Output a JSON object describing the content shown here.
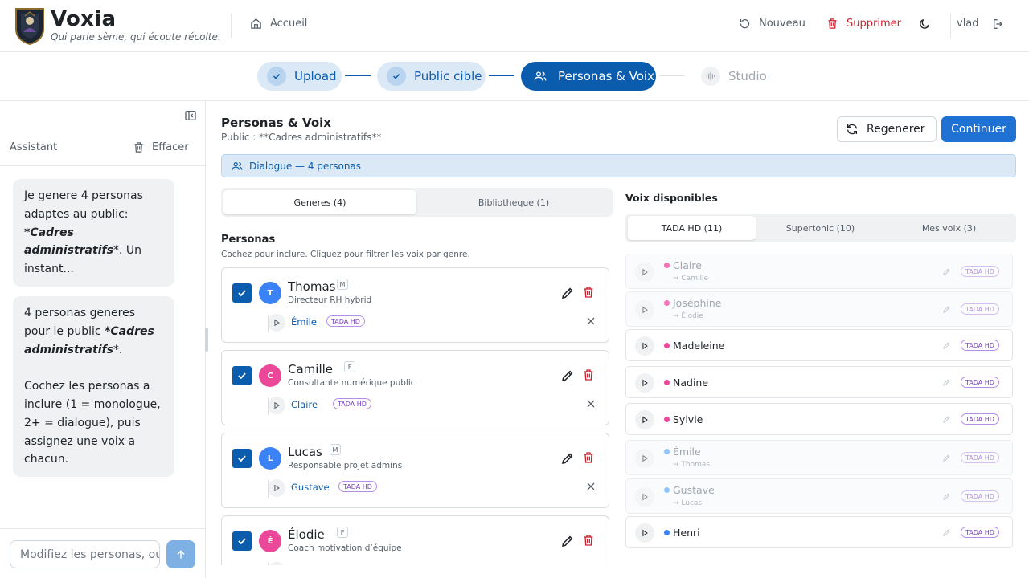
{
  "header": {
    "brand": "Voxia",
    "tagline": "Qui parle sème, qui écoute récolte.",
    "home_label": "Accueil",
    "new_label": "Nouveau",
    "delete_label": "Supprimer",
    "user": "vlad"
  },
  "stepper": [
    {
      "label": "Upload",
      "state": "done"
    },
    {
      "label": "Public cible",
      "state": "done"
    },
    {
      "label": "Personas & Voix",
      "state": "active"
    },
    {
      "label": "Studio",
      "state": "todo"
    }
  ],
  "sidebar": {
    "title": "Assistant",
    "clear_label": "Effacer",
    "messages": [
      {
        "parts": [
          {
            "t": "Je genere 4 personas adaptes au public: "
          },
          {
            "b": "*Cadres administratifs"
          },
          {
            "t": "*. Un instant..."
          }
        ]
      },
      {
        "parts": [
          {
            "t": "4 personas generes pour le public "
          },
          {
            "b": "*Cadres administratifs"
          },
          {
            "t": "*.\n\nCochez les personas a inclure (1 = monologue, 2+ = dialogue), puis assignez une voix a chacun."
          }
        ]
      }
    ],
    "input_placeholder": "Modifiez les personas, ou posez une question..."
  },
  "main": {
    "title": "Personas & Voix",
    "subtitle": "Public : **Cadres administratifs**",
    "regen_label": "Regenerer",
    "continue_label": "Continuer",
    "banner": "Dialogue — 4 personas",
    "persona_tabs": [
      "Generes (4)",
      "Bibliotheque (1)"
    ],
    "personas_title": "Personas",
    "personas_hint": "Cochez pour inclure. Cliquez pour filtrer les voix par genre.",
    "personas": [
      {
        "initial": "T",
        "name": "Thomas",
        "gender": "M",
        "role": "Directeur RH hybrid",
        "voice": "Émile",
        "engine": "TADA HD",
        "color": "#3b82f6",
        "checked": true
      },
      {
        "initial": "C",
        "name": "Camille",
        "gender": "F",
        "role": "Consultante numérique public",
        "voice": "Claire",
        "engine": "TADA HD",
        "color": "#ec4899",
        "checked": true
      },
      {
        "initial": "L",
        "name": "Lucas",
        "gender": "M",
        "role": "Responsable projet admins",
        "voice": "Gustave",
        "engine": "TADA HD",
        "color": "#3b82f6",
        "checked": true
      },
      {
        "initial": "É",
        "name": "Élodie",
        "gender": "F",
        "role": "Coach motivation d’équipe",
        "voice": "",
        "engine": "",
        "color": "#ec4899",
        "checked": true
      }
    ],
    "voices_title": "Voix disponibles",
    "voice_tabs": [
      "TADA HD (11)",
      "Supertonic (10)",
      "Mes voix (3)"
    ],
    "voices": [
      {
        "name": "Claire",
        "used_by": "→ Camille",
        "engine": "TADA HD",
        "gender_color": "#f472b6",
        "used": true
      },
      {
        "name": "Joséphine",
        "used_by": "→ Élodie",
        "engine": "TADA HD",
        "gender_color": "#f472b6",
        "used": true
      },
      {
        "name": "Madeleine",
        "used_by": "",
        "engine": "TADA HD",
        "gender_color": "#ec4899",
        "used": false
      },
      {
        "name": "Nadine",
        "used_by": "",
        "engine": "TADA HD",
        "gender_color": "#ec4899",
        "used": false
      },
      {
        "name": "Sylvie",
        "used_by": "",
        "engine": "TADA HD",
        "gender_color": "#ec4899",
        "used": false
      },
      {
        "name": "Émile",
        "used_by": "→ Thomas",
        "engine": "TADA HD",
        "gender_color": "#93c5fd",
        "used": true
      },
      {
        "name": "Gustave",
        "used_by": "→ Lucas",
        "engine": "TADA HD",
        "gender_color": "#93c5fd",
        "used": true
      },
      {
        "name": "Henri",
        "used_by": "",
        "engine": "TADA HD",
        "gender_color": "#3b82f6",
        "used": false
      }
    ]
  }
}
